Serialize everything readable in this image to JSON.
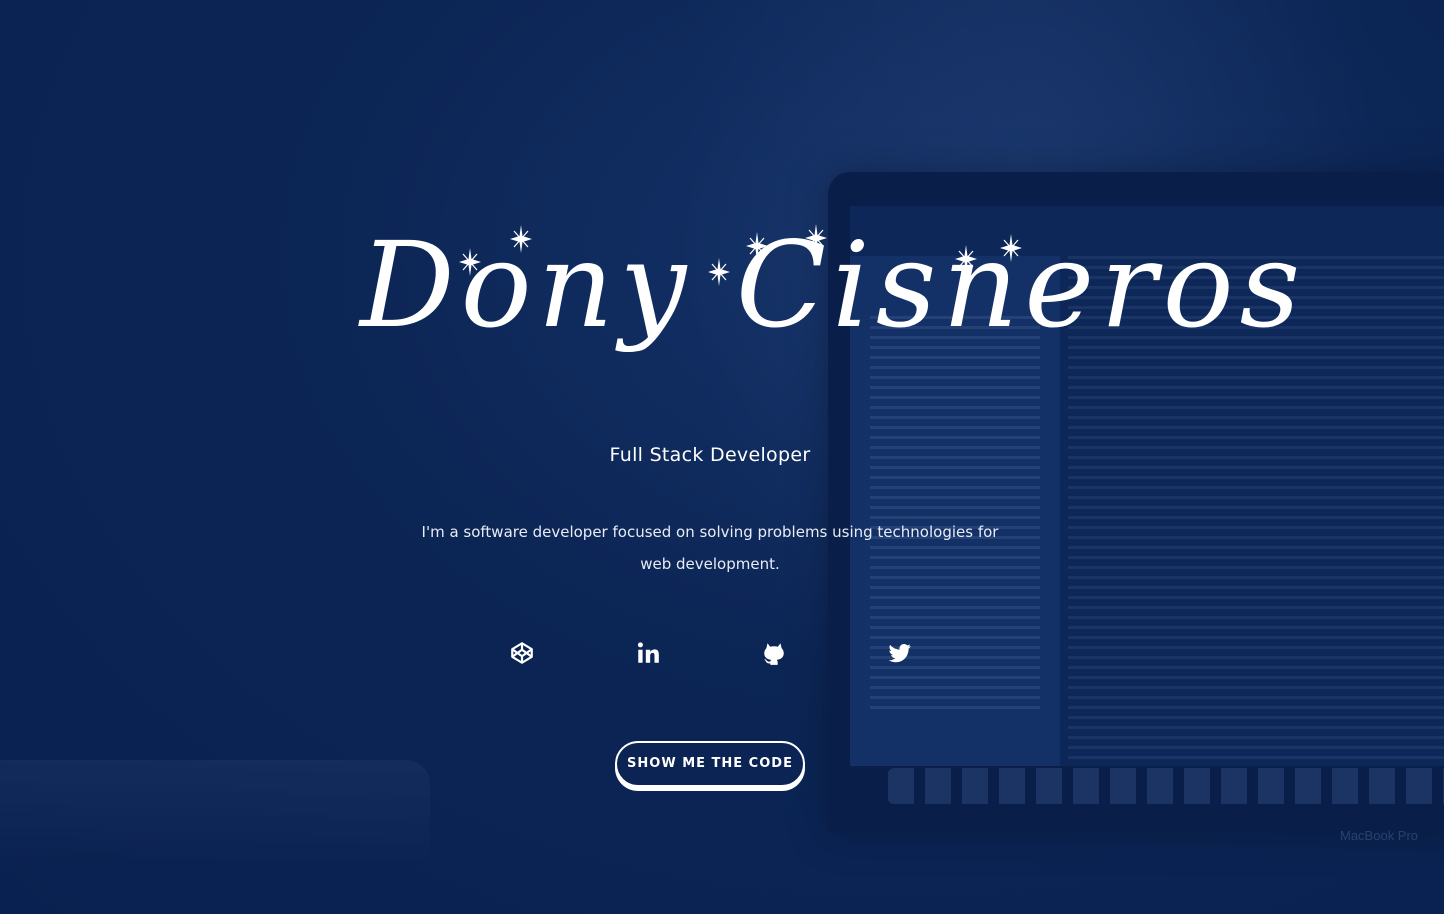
{
  "hero": {
    "name": "Dony Cisneros",
    "role": "Full Stack Developer",
    "description": "I'm a software developer focused on solving problems using technologies for web development.",
    "cta_label": "SHOW ME THE CODE"
  },
  "background": {
    "laptop_brand": "MacBook Pro"
  },
  "socials": [
    {
      "icon": "codepen-icon"
    },
    {
      "icon": "linkedin-icon"
    },
    {
      "icon": "github-icon"
    },
    {
      "icon": "twitter-icon"
    }
  ],
  "colors": {
    "background": "#0c2555",
    "text": "#ffffff",
    "button_bg": "#0b2453",
    "button_border": "#ffffff"
  }
}
